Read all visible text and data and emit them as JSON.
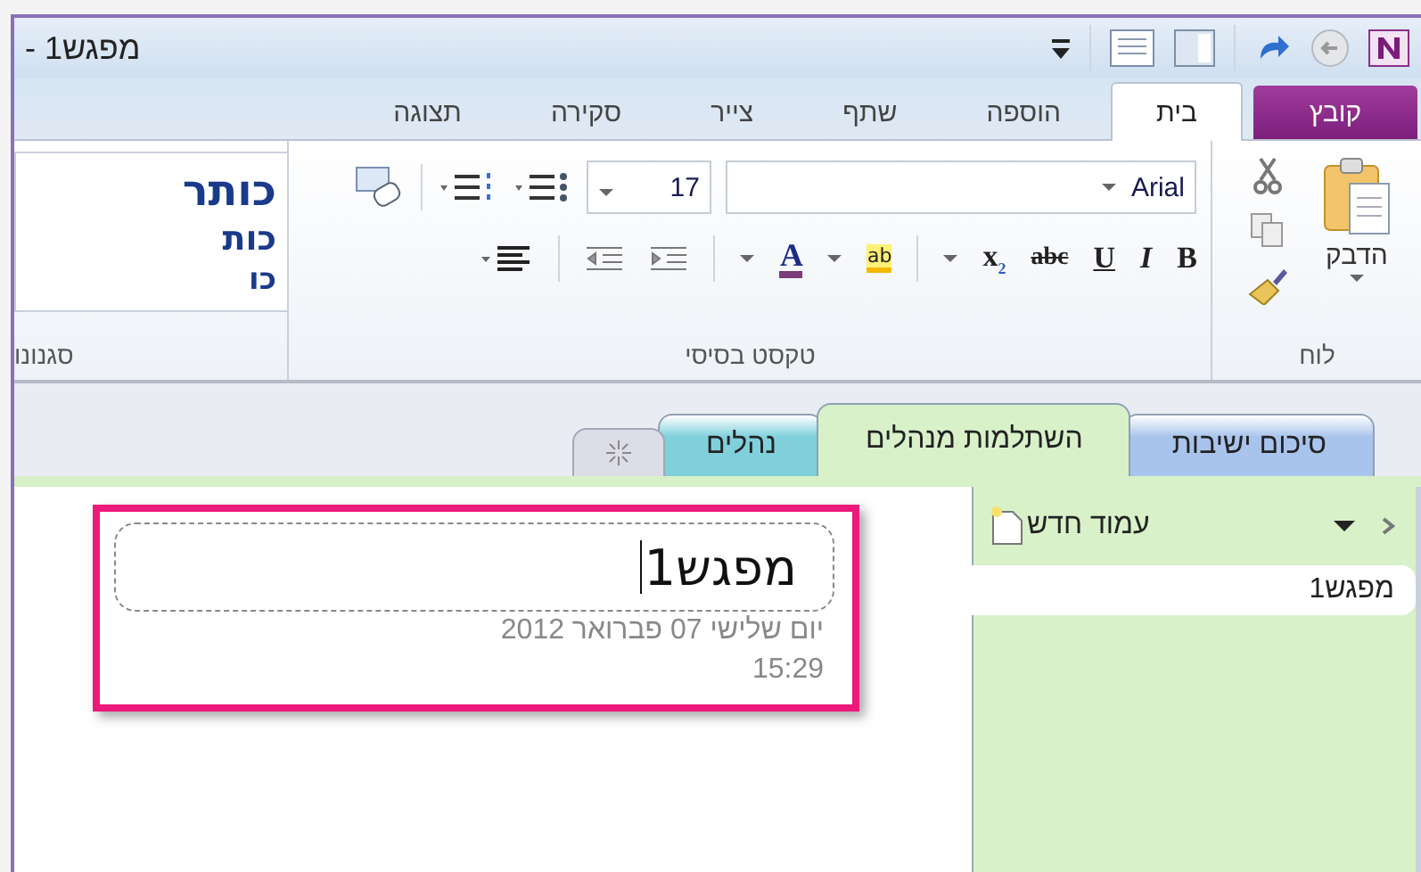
{
  "window": {
    "title": "מפגש1 -"
  },
  "ribbon_tabs": [
    {
      "label": "קובץ",
      "kind": "file",
      "selected": false
    },
    {
      "label": "בית",
      "kind": "tab",
      "selected": true
    },
    {
      "label": "הוספה",
      "kind": "tab",
      "selected": false
    },
    {
      "label": "שתף",
      "kind": "tab",
      "selected": false
    },
    {
      "label": "צייר",
      "kind": "tab",
      "selected": false
    },
    {
      "label": "סקירה",
      "kind": "tab",
      "selected": false
    },
    {
      "label": "תצוגה",
      "kind": "tab",
      "selected": false
    }
  ],
  "clipboard": {
    "label": "לוח",
    "paste": "הדבק"
  },
  "basic_text": {
    "label": "טקסט בסיסי",
    "font": "Arial",
    "size": "17",
    "format_buttons": [
      {
        "kind": "bold",
        "glyph": "B"
      },
      {
        "kind": "italic",
        "glyph": "I"
      },
      {
        "kind": "underline",
        "glyph": "U"
      },
      {
        "kind": "strike",
        "glyph": "abc"
      },
      {
        "kind": "subscript",
        "glyph": "x",
        "sub": "2"
      }
    ],
    "highlight": "ab",
    "font_color": "A"
  },
  "styles": {
    "label": "סגנונו",
    "items": [
      {
        "kind": "h1",
        "label": "כותר"
      },
      {
        "kind": "h2",
        "label": "כות"
      },
      {
        "kind": "h3",
        "label": "כו"
      }
    ]
  },
  "section_tabs": [
    {
      "label": "סיכום ישיבות",
      "color": "#a9c4ec",
      "selected": false
    },
    {
      "label": "השתלמות מנהלים",
      "color": "#d8f1c9",
      "selected": true
    },
    {
      "label": "נהלים",
      "color": "#80d0dc",
      "selected": false
    }
  ],
  "page_list": {
    "new_page": "עמוד חדש",
    "pages": [
      {
        "label": "מפגש1",
        "selected": true
      }
    ]
  },
  "page": {
    "title": "מפגש1",
    "date": "יום שלישי 07 פברואר 2012",
    "time": "15:29"
  }
}
